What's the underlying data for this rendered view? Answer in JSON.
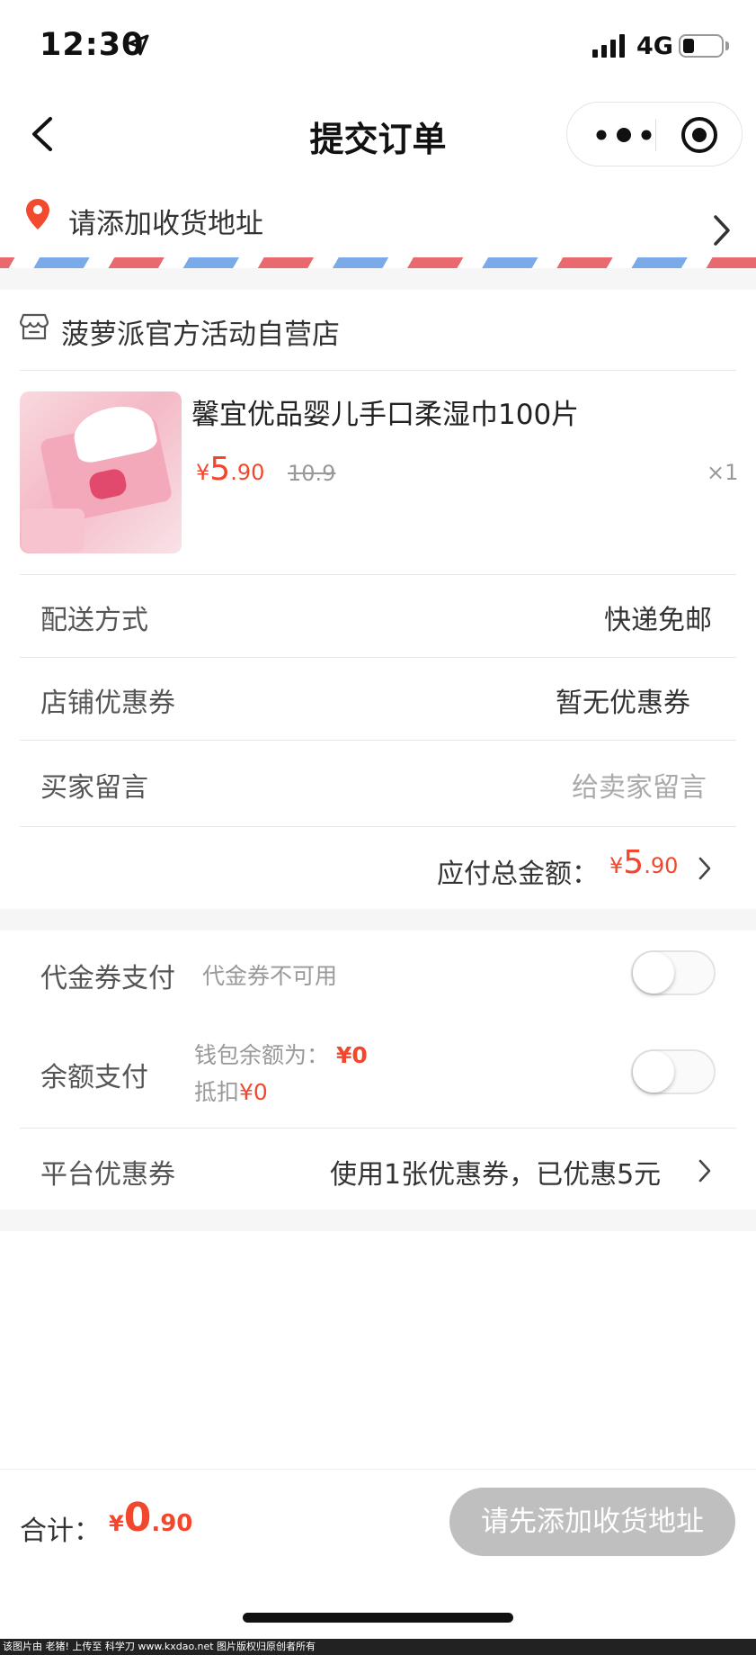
{
  "status_bar": {
    "time": "12:30",
    "network": "4G"
  },
  "nav": {
    "title": "提交订单"
  },
  "address": {
    "prompt": "请添加收货地址"
  },
  "store": {
    "name": "菠萝派官方活动自营店"
  },
  "product": {
    "title": "馨宜优品婴儿手口柔湿巾100片",
    "price_symbol": "¥",
    "price_integer": "5",
    "price_decimal": ".90",
    "original_price": "10.9",
    "quantity": "×1"
  },
  "order_rows": {
    "delivery_label": "配送方式",
    "delivery_value": "快递免邮",
    "store_coupon_label": "店铺优惠券",
    "store_coupon_value": "暂无优惠券",
    "message_label": "买家留言",
    "message_placeholder": "给卖家留言"
  },
  "total": {
    "label": "应付总金额：",
    "symbol": "¥",
    "integer": "5",
    "decimal": ".90"
  },
  "payment": {
    "voucher_label": "代金券支付",
    "voucher_note": "代金券不可用",
    "voucher_enabled": false,
    "balance_label": "余额支付",
    "wallet_label": "钱包余额为：",
    "wallet_amount": "¥0",
    "deduct_label": "抵扣",
    "deduct_amount": "¥0",
    "balance_enabled": false,
    "platform_coupon_label": "平台优惠券",
    "platform_coupon_value": "使用1张优惠券，已优惠5元"
  },
  "bottom_bar": {
    "sum_label": "合计：",
    "sum_symbol": "¥",
    "sum_integer": "0",
    "sum_decimal": ".90",
    "submit_label": "请先添加收货地址"
  },
  "watermark": "该图片由 老猪! 上传至 科学刀 www.kxdao.net 图片版权归原创者所有",
  "colors": {
    "price_red": "#f2472d",
    "disabled_button": "#bfbfbf",
    "airmail_red": "#e86a6e",
    "airmail_blue": "#7aaae8"
  }
}
